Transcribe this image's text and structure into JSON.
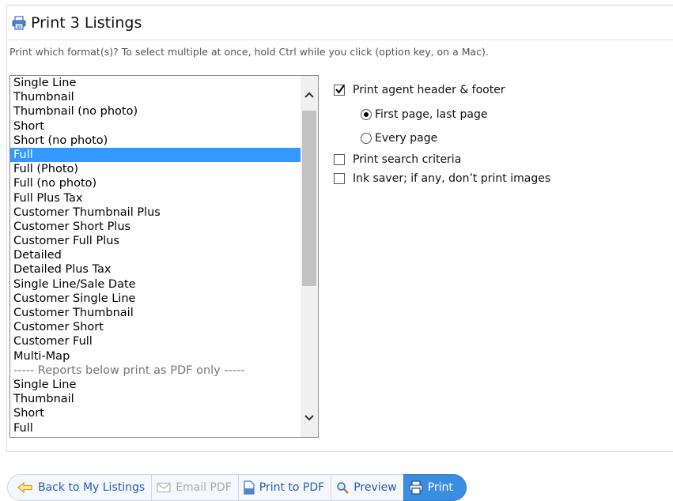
{
  "dialog": {
    "title": "Print 3 Listings",
    "instructions": "Print which format(s)? To select multiple at once, hold Ctrl while you click (option key, on a Mac)."
  },
  "formats": [
    {
      "label": "Single Line"
    },
    {
      "label": "Thumbnail"
    },
    {
      "label": "Thumbnail (no photo)"
    },
    {
      "label": "Short"
    },
    {
      "label": "Short (no photo)"
    },
    {
      "label": "Full",
      "selected": true
    },
    {
      "label": "Full (Photo)"
    },
    {
      "label": "Full (no photo)"
    },
    {
      "label": "Full Plus Tax"
    },
    {
      "label": "Customer Thumbnail Plus"
    },
    {
      "label": "Customer Short Plus"
    },
    {
      "label": "Customer Full Plus"
    },
    {
      "label": "Detailed"
    },
    {
      "label": "Detailed Plus Tax"
    },
    {
      "label": "Single Line/Sale Date"
    },
    {
      "label": "Customer Single Line"
    },
    {
      "label": "Customer Thumbnail"
    },
    {
      "label": "Customer Short"
    },
    {
      "label": "Customer Full"
    },
    {
      "label": "Multi-Map"
    },
    {
      "label": "----- Reports below print as PDF only -----",
      "separator": true
    },
    {
      "label": "Single Line"
    },
    {
      "label": "Thumbnail"
    },
    {
      "label": "Short"
    },
    {
      "label": "Full"
    }
  ],
  "options": {
    "agent_header_footer": {
      "label": "Print agent header & footer",
      "checked": true
    },
    "first_last_page": {
      "label": "First page, last page",
      "selected": true
    },
    "every_page": {
      "label": "Every page",
      "selected": false
    },
    "search_criteria": {
      "label": "Print search criteria",
      "checked": false
    },
    "ink_saver": {
      "label": "Ink saver; if any, don’t print images",
      "checked": false
    }
  },
  "toolbar": {
    "back_label": "Back to My Listings",
    "email_pdf_label": "Email PDF",
    "print_to_pdf_label": "Print to PDF",
    "preview_label": "Preview",
    "print_label": "Print"
  }
}
